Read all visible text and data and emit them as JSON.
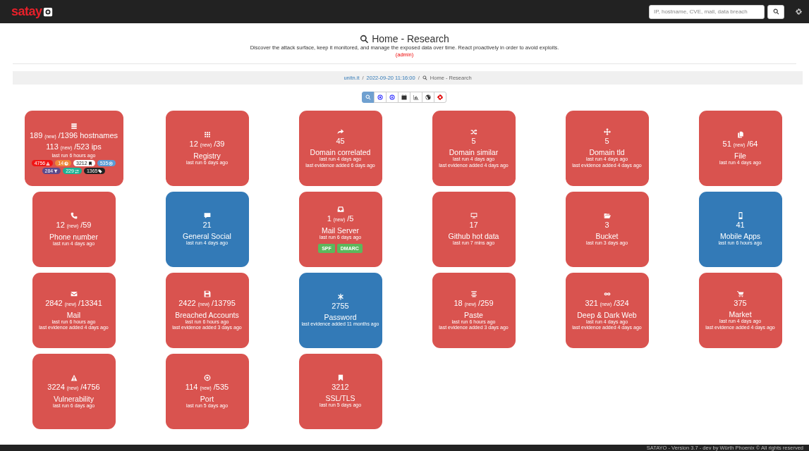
{
  "navbar": {
    "brand": "satay",
    "search": {
      "placeholder": "IP, hostname, CVE, mail, data breach"
    }
  },
  "header": {
    "title": "Home - Research",
    "subtitle": "Discover the attack surface, keep it monitored, and manage the exposed data over time. React proactively in order to avoid exploits.",
    "role": "(admin)"
  },
  "breadcrumb": {
    "separator": "/",
    "items": [
      "unitn.it",
      "2022-09-20 11:16:00",
      "Home - Research"
    ]
  },
  "toolbar": [
    {
      "selected": true
    },
    {
      "selected": false
    },
    {
      "selected": false
    },
    {
      "selected": false
    },
    {
      "selected": false
    },
    {
      "selected": false
    },
    {
      "selected": false
    }
  ],
  "tiles": [
    {
      "color": "#d9534f",
      "counts": [
        {
          "new": "189",
          "new_label": "(new)",
          "total": "/1396 hostnames"
        },
        {
          "new": "113",
          "new_label": "(new)",
          "total": "/523 ips"
        }
      ],
      "notes": [
        "last run 6 hours ago"
      ],
      "badges": [
        {
          "text": "4756",
          "color": "#f01414"
        },
        {
          "text": "14",
          "color": "#f0883a"
        },
        {
          "text": "3212",
          "color": "#ffffff"
        },
        {
          "text": "535",
          "color": "#5b9bd5"
        },
        {
          "text": "284",
          "color": "#5b4a8b"
        },
        {
          "text": "229",
          "color": "#1ab394"
        },
        {
          "text": "1365",
          "color": "#222222"
        }
      ]
    },
    {
      "color": "#d9534f",
      "counts": [
        {
          "new": "12",
          "new_label": "(new)",
          "total": "/39"
        }
      ],
      "label": "Registry",
      "notes": [
        "last run 6 days ago"
      ]
    },
    {
      "color": "#d9534f",
      "counts": [
        {
          "total": "45"
        }
      ],
      "label": "Domain correlated",
      "notes": [
        "last run 4 days ago",
        "last evidence added 6 days ago"
      ]
    },
    {
      "color": "#d9534f",
      "counts": [
        {
          "total": "5"
        }
      ],
      "label": "Domain similar",
      "notes": [
        "last run 4 days ago",
        "last evidence added 4 days ago"
      ]
    },
    {
      "color": "#d9534f",
      "counts": [
        {
          "total": "5"
        }
      ],
      "label": "Domain tld",
      "notes": [
        "last run 4 days ago",
        "last evidence added 4 days ago"
      ]
    },
    {
      "color": "#d9534f",
      "counts": [
        {
          "new": "51",
          "new_label": "(new)",
          "total": "/64"
        }
      ],
      "label": "File",
      "notes": [
        "last run 4 days ago"
      ]
    },
    {
      "color": "#d9534f",
      "counts": [
        {
          "new": "12",
          "new_label": "(new)",
          "total": "/59"
        }
      ],
      "label": "Phone number",
      "notes": [
        "last run 4 days ago"
      ]
    },
    {
      "color": "#337ab7",
      "counts": [
        {
          "total": "21"
        }
      ],
      "label": "General Social",
      "notes": [
        "last run 4 days ago"
      ]
    },
    {
      "color": "#d9534f",
      "counts": [
        {
          "new": "1",
          "new_label": "(new)",
          "total": "/5"
        }
      ],
      "label": "Mail Server",
      "notes": [
        "last run 6 days ago"
      ],
      "badges": [
        {
          "text": "SPF",
          "color": "#5cb85c"
        },
        {
          "text": "DMARC",
          "color": "#5cb85c"
        }
      ]
    },
    {
      "color": "#d9534f",
      "counts": [
        {
          "total": "17"
        }
      ],
      "label": "Github hot data",
      "notes": [
        "last run 7 mins ago"
      ]
    },
    {
      "color": "#d9534f",
      "counts": [
        {
          "total": "3"
        }
      ],
      "label": "Bucket",
      "notes": [
        "last run 3 days ago"
      ]
    },
    {
      "color": "#337ab7",
      "counts": [
        {
          "total": "41"
        }
      ],
      "label": "Mobile Apps",
      "notes": [
        "last run 6 hours ago"
      ]
    },
    {
      "color": "#d9534f",
      "counts": [
        {
          "new": "2842",
          "new_label": "(new)",
          "total": "/13341"
        }
      ],
      "label": "Mail",
      "notes": [
        "last run 6 hours ago",
        "last evidence added 4 days ago"
      ]
    },
    {
      "color": "#d9534f",
      "counts": [
        {
          "new": "2422",
          "new_label": "(new)",
          "total": "/13795"
        }
      ],
      "label": "Breached Accounts",
      "notes": [
        "last run 6 hours ago",
        "last evidence added 3 days ago"
      ]
    },
    {
      "color": "#337ab7",
      "counts": [
        {
          "total": "2755"
        }
      ],
      "label": "Password",
      "notes": [
        "last evidence added 11 months ago"
      ]
    },
    {
      "color": "#d9534f",
      "counts": [
        {
          "new": "18",
          "new_label": "(new)",
          "total": "/259"
        }
      ],
      "label": "Paste",
      "notes": [
        "last run 6 hours ago",
        "last evidence added 3 days ago"
      ]
    },
    {
      "color": "#d9534f",
      "counts": [
        {
          "new": "321",
          "new_label": "(new)",
          "total": "/324"
        }
      ],
      "label": "Deep & Dark Web",
      "notes": [
        "last run 4 days ago",
        "last evidence added 4 days ago"
      ]
    },
    {
      "color": "#d9534f",
      "counts": [
        {
          "total": "375"
        }
      ],
      "label": "Market",
      "notes": [
        "last run 4 days ago",
        "last evidence added 4 days ago"
      ]
    },
    {
      "color": "#d9534f",
      "counts": [
        {
          "new": "3224",
          "new_label": "(new)",
          "total": "/4756"
        }
      ],
      "label": "Vulnerability",
      "notes": [
        "last run 6 days ago"
      ]
    },
    {
      "color": "#d9534f",
      "counts": [
        {
          "new": "114",
          "new_label": "(new)",
          "total": "/535"
        }
      ],
      "label": "Port",
      "notes": [
        "last run 5 days ago"
      ]
    },
    {
      "color": "#d9534f",
      "counts": [
        {
          "total": "3212"
        }
      ],
      "label": "SSL/TLS",
      "notes": [
        "last run 5 days ago"
      ]
    }
  ],
  "footer": "SATAYO - Version 3.7 - dev by Würth Phoenix © All rights reserved"
}
